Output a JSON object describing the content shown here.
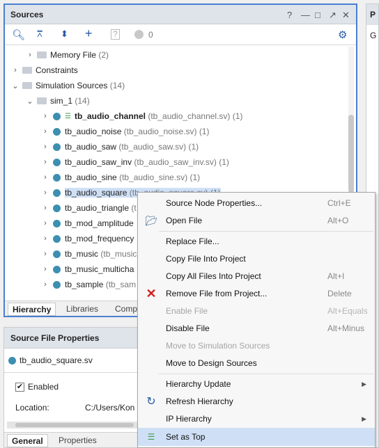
{
  "sources_panel": {
    "title": "Sources",
    "controls": [
      "?",
      "—",
      "□",
      "↗",
      "✕"
    ],
    "status_count": "0",
    "tree": [
      {
        "label": "Memory File",
        "detail": "(2)",
        "kind": "folder",
        "expander": "›"
      },
      {
        "label": "Constraints",
        "detail": "",
        "kind": "folder",
        "expander": "›"
      },
      {
        "label": "Simulation Sources",
        "detail": "(14)",
        "kind": "folder",
        "expander": "⌄"
      },
      {
        "label": "sim_1",
        "detail": "(14)",
        "kind": "folder",
        "expander": "⌄"
      },
      {
        "label": "tb_audio_channel",
        "detail": "(tb_audio_channel.sv) (1)",
        "kind": "top"
      },
      {
        "label": "tb_audio_noise",
        "detail": "(tb_audio_noise.sv) (1)",
        "kind": "file"
      },
      {
        "label": "tb_audio_saw",
        "detail": "(tb_audio_saw.sv) (1)",
        "kind": "file"
      },
      {
        "label": "tb_audio_saw_inv",
        "detail": "(tb_audio_saw_inv.sv) (1)",
        "kind": "file"
      },
      {
        "label": "tb_audio_sine",
        "detail": "(tb_audio_sine.sv) (1)",
        "kind": "file"
      },
      {
        "label": "tb_audio_square",
        "detail": "(tb_audio_square.sv) (1)",
        "kind": "file"
      },
      {
        "label": "tb_audio_triangle",
        "detail": "(t",
        "kind": "file"
      },
      {
        "label": "tb_mod_amplitude",
        "detail": "",
        "kind": "file"
      },
      {
        "label": "tb_mod_frequency",
        "detail": "",
        "kind": "file"
      },
      {
        "label": "tb_music",
        "detail": "(tb_music",
        "kind": "file"
      },
      {
        "label": "tb_music_multicha",
        "detail": "",
        "kind": "file"
      },
      {
        "label": "tb_sample",
        "detail": "(tb_sam",
        "kind": "file"
      }
    ],
    "tabs": [
      "Hierarchy",
      "Libraries",
      "Comp"
    ]
  },
  "source_file_properties": {
    "title": "Source File Properties",
    "file_name": "tb_audio_square.sv",
    "enabled_label": "Enabled",
    "location_label": "Location:",
    "location_value": "C:/Users/Kon",
    "tabs": [
      "General",
      "Properties"
    ]
  },
  "right_panel": {
    "title": "P",
    "letter": "G"
  },
  "context_menu": [
    {
      "label": "Source Node Properties...",
      "shortcut": "Ctrl+E",
      "icon": "",
      "disabled": false
    },
    {
      "label": "Open File",
      "shortcut": "Alt+O",
      "icon": "folder-open-icon",
      "disabled": false
    },
    {
      "sep": true
    },
    {
      "label": "Replace File...",
      "shortcut": "",
      "icon": "",
      "disabled": false
    },
    {
      "label": "Copy File Into Project",
      "shortcut": "",
      "icon": "",
      "disabled": false
    },
    {
      "label": "Copy All Files Into Project",
      "shortcut": "Alt+I",
      "icon": "",
      "disabled": false
    },
    {
      "label": "Remove File from Project...",
      "shortcut": "Delete",
      "icon": "remove-icon",
      "disabled": false
    },
    {
      "label": "Enable File",
      "shortcut": "Alt+Equals",
      "icon": "",
      "disabled": true
    },
    {
      "label": "Disable File",
      "shortcut": "Alt+Minus",
      "icon": "",
      "disabled": false
    },
    {
      "label": "Move to Simulation Sources",
      "shortcut": "",
      "icon": "",
      "disabled": true
    },
    {
      "label": "Move to Design Sources",
      "shortcut": "",
      "icon": "",
      "disabled": false
    },
    {
      "sep": true
    },
    {
      "label": "Hierarchy Update",
      "shortcut": "",
      "icon": "",
      "disabled": false,
      "submenu": true
    },
    {
      "label": "Refresh Hierarchy",
      "shortcut": "",
      "icon": "refresh-icon",
      "disabled": false
    },
    {
      "label": "IP Hierarchy",
      "shortcut": "",
      "icon": "",
      "disabled": false,
      "submenu": true
    },
    {
      "label": "Set as Top",
      "shortcut": "",
      "icon": "set-top-icon",
      "disabled": false,
      "highlighted": true
    }
  ],
  "colors": {
    "accent": "#4a7fd0",
    "selection": "#cfe0f6",
    "file_dot": "#3c8fb0",
    "remove_red": "#d42020"
  }
}
